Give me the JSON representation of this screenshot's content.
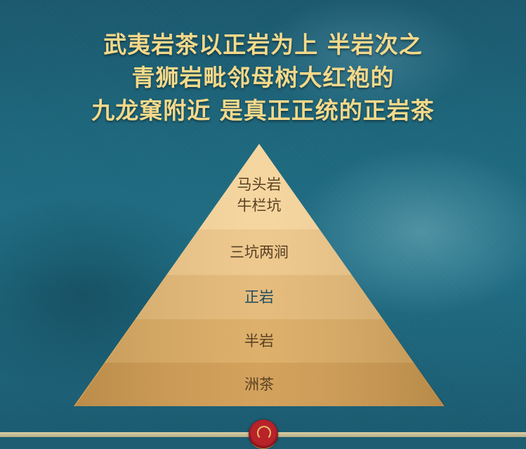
{
  "heading": {
    "line1": "武夷岩茶以正岩为上  半岩次之",
    "line2": "青狮岩毗邻母树大红袍的",
    "line3": "九龙窠附近 是真正正统的正岩茶"
  },
  "pyramid": {
    "tiers": [
      {
        "lines": [
          "马头岩",
          "牛栏坑"
        ],
        "color": "#f6d49a"
      },
      {
        "lines": [
          "三坑两涧"
        ],
        "color": "#edc688"
      },
      {
        "lines": [
          "正岩"
        ],
        "color": "#e4b875",
        "text_color": "#1c4a63"
      },
      {
        "lines": [
          "半岩"
        ],
        "color": "#dbab62"
      },
      {
        "lines": [
          "洲茶"
        ],
        "color": "#d09c52"
      }
    ]
  },
  "colors": {
    "background": "#1f5d72",
    "heading_text": "#f4d98a",
    "tier_text": "#5a4022"
  },
  "icons": {
    "medallion": "red-seal-emblem"
  }
}
